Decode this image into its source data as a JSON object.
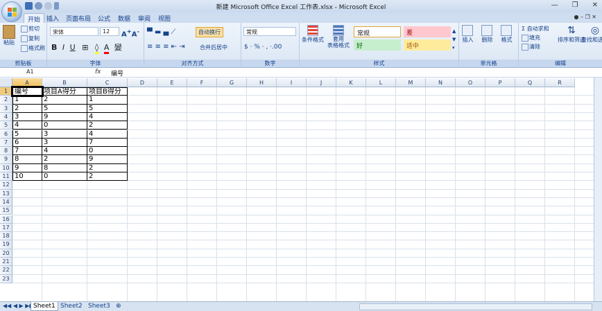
{
  "window": {
    "title": "新建 Microsoft Office Excel 工作表.xlsx - Microsoft Excel"
  },
  "tabs": [
    "开始",
    "插入",
    "页面布局",
    "公式",
    "数据",
    "审阅",
    "视图"
  ],
  "clipboard": {
    "paste": "粘贴",
    "cut": "剪切",
    "copy": "复制",
    "format_painter": "格式刷",
    "label": "剪贴板"
  },
  "font": {
    "name": "宋体",
    "size": "12",
    "bold": "B",
    "italic": "I",
    "underline": "U",
    "label": "字体"
  },
  "alignment": {
    "wrap": "自动换行",
    "merge": "合并后居中",
    "label": "对齐方式"
  },
  "number": {
    "format": "常规",
    "percent": "%",
    "label": "数字"
  },
  "styles": {
    "conditional": "条件格式",
    "table_format": "套用\n表格格式",
    "normal": "常规",
    "bad": "差",
    "good": "好",
    "neutral": "适中",
    "label": "样式",
    "colors": {
      "bad_bg": "#ffc7ce",
      "good_bg": "#c6efce",
      "neutral_bg": "#ffeb9c",
      "bad_fg": "#9c0006",
      "good_fg": "#006100",
      "neutral_fg": "#9c5700"
    }
  },
  "cells_group": {
    "insert": "插入",
    "delete": "删除",
    "format": "格式",
    "label": "单元格"
  },
  "editing": {
    "autosum": "自动求和",
    "fill": "填充",
    "clear": "清除",
    "sort": "排序和筛选",
    "find": "查找和选择",
    "label": "编辑"
  },
  "formula_bar": {
    "name_box": "A1",
    "fx": "fx",
    "content": "编号"
  },
  "columns": [
    "A",
    "B",
    "C",
    "D",
    "E",
    "F",
    "G",
    "H",
    "I",
    "J",
    "K",
    "L",
    "M",
    "N",
    "O",
    "P",
    "Q",
    "R"
  ],
  "rows": [
    "1",
    "2",
    "3",
    "4",
    "5",
    "6",
    "7",
    "8",
    "9",
    "10",
    "11",
    "12",
    "13",
    "14",
    "15",
    "16",
    "17",
    "18",
    "19",
    "20",
    "21",
    "22",
    "23"
  ],
  "table": {
    "headers": [
      "编号",
      "项目A得分",
      "项目B得分"
    ],
    "rows": [
      [
        "1",
        "2",
        "1"
      ],
      [
        "2",
        "5",
        "5"
      ],
      [
        "3",
        "9",
        "4"
      ],
      [
        "4",
        "0",
        "2"
      ],
      [
        "5",
        "3",
        "4"
      ],
      [
        "6",
        "3",
        "7"
      ],
      [
        "7",
        "4",
        "0"
      ],
      [
        "8",
        "2",
        "9"
      ],
      [
        "9",
        "8",
        "2"
      ],
      [
        "10",
        "0",
        "2"
      ]
    ]
  },
  "sheets": [
    "Sheet1",
    "Sheet2",
    "Sheet3"
  ]
}
